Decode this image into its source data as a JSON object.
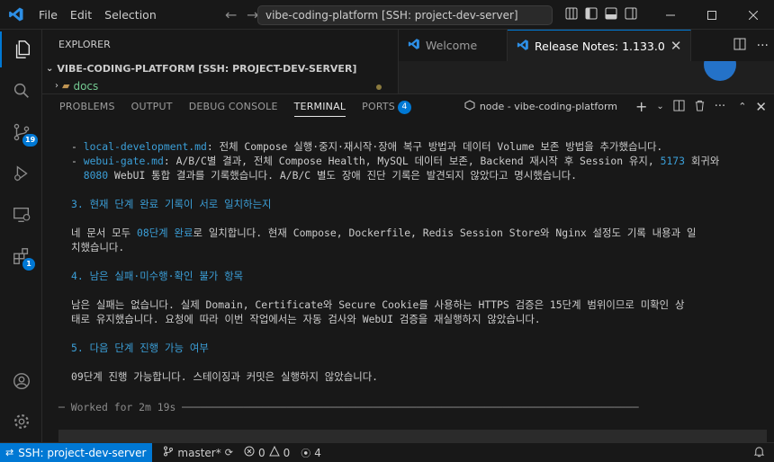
{
  "titlebar": {
    "menus": [
      "File",
      "Edit",
      "Selection"
    ],
    "command_center": "vibe-coding-platform [SSH: project-dev-server]"
  },
  "activity": {
    "source_control_badge": "19",
    "extensions_badge": "1"
  },
  "explorer": {
    "title": "EXPLORER",
    "folder": "VIBE-CODING-PLATFORM [SSH: PROJECT-DEV-SERVER]",
    "row": "docs"
  },
  "editor": {
    "tabs": [
      {
        "label": "Welcome"
      },
      {
        "label": "Release Notes: 1.133.0"
      }
    ]
  },
  "panel": {
    "tabs": [
      "PROBLEMS",
      "OUTPUT",
      "DEBUG CONSOLE",
      "TERMINAL",
      "PORTS"
    ],
    "ports_count": "4",
    "terminal_name": "node - vibe-coding-platform"
  },
  "terminal": {
    "l1_prefix": "- ",
    "l1_link": "local-development.md",
    "l1_text": ": 전체 Compose 실행·중지·재시작·장애 복구 방법과 데이터 Volume 보존 방법을 추가했습니다.",
    "l2_prefix": "- ",
    "l2_link": "webui-gate.md",
    "l2_text": ": A/B/C별 결과, 전체 Compose Health, MySQL 데이터 보존, Backend 재시작 후 Session 유지, ",
    "l2_num": "5173",
    "l2_tail": " 회귀와",
    "l3_indent": "  ",
    "l3_num": "8080",
    "l3_text": " WebUI 통합 결과를 기록했습니다. A/B/C 별도 장애 진단 기록은 발견되지 않았다고 명시했습니다.",
    "h3": "3. 현재 단계 완료 기록이 서로 일치하는지",
    "p3a_pre": "네 문서 모두 ",
    "p3a_link": "08단계 완료",
    "p3a_post": "로 일치합니다. 현재 Compose, Dockerfile, Redis Session Store와 Nginx 설정도 기록 내용과 일",
    "p3b": "치했습니다.",
    "h4": "4. 남은 실패·미수행·확인 불가 항목",
    "p4a": "남은 실패는 없습니다. 실제 Domain, Certificate와 Secure Cookie를 사용하는 HTTPS 검증은 15단계 범위이므로 미확인 상",
    "p4b": "태로 유지했습니다. 요청에 따라 이번 작업에서는 자동 검사와 WebUI 검증을 재실행하지 않았습니다.",
    "h5": "5. 다음 단계 진행 가능 여부",
    "p5": "09단계 진행 가능합니다. 스테이징과 커밋은 실행하지 않았습니다.",
    "worked": "─ Worked for 2m 19s ──────────────────────────────────────────────────────────────────────────"
  },
  "statusbar": {
    "remote": "SSH: project-dev-server",
    "branch": "master*",
    "errors": "0",
    "warnings": "0",
    "ports": "4"
  }
}
